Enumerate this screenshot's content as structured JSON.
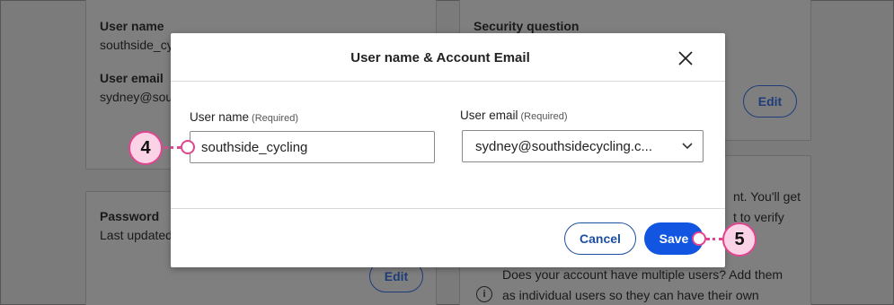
{
  "background": {
    "left_top_card": {
      "user_name_label": "User name",
      "user_name_value": "southside_cy",
      "user_email_label": "User email",
      "user_email_value": "sydney@sou"
    },
    "right_top_card": {
      "security_question_label": "Security question",
      "edit_label": "Edit"
    },
    "left_bottom_card": {
      "password_label": "Password",
      "last_updated": "Last updated",
      "edit_label": "Edit"
    },
    "right_bottom_card": {
      "line1": "nt. You'll get",
      "line2": "t to verify",
      "info_line1": "Does your account have multiple users? Add them",
      "info_line2": "as individual users so they can have their own",
      "info_icon": "i"
    }
  },
  "modal": {
    "title": "User name & Account Email",
    "close_icon": "close-icon",
    "user_name": {
      "label": "User name",
      "required": "(Required)",
      "value": "southside_cycling"
    },
    "user_email": {
      "label": "User email",
      "required": "(Required)",
      "value": "sydney@southsidecycling.c..."
    },
    "cancel_label": "Cancel",
    "save_label": "Save"
  },
  "callouts": {
    "step_4": "4",
    "step_5": "5"
  },
  "colors": {
    "primary": "#1155e0",
    "outline_button": "#1d4fa0",
    "callout_border": "#e0458f",
    "callout_fill": "#fbd3e6"
  }
}
